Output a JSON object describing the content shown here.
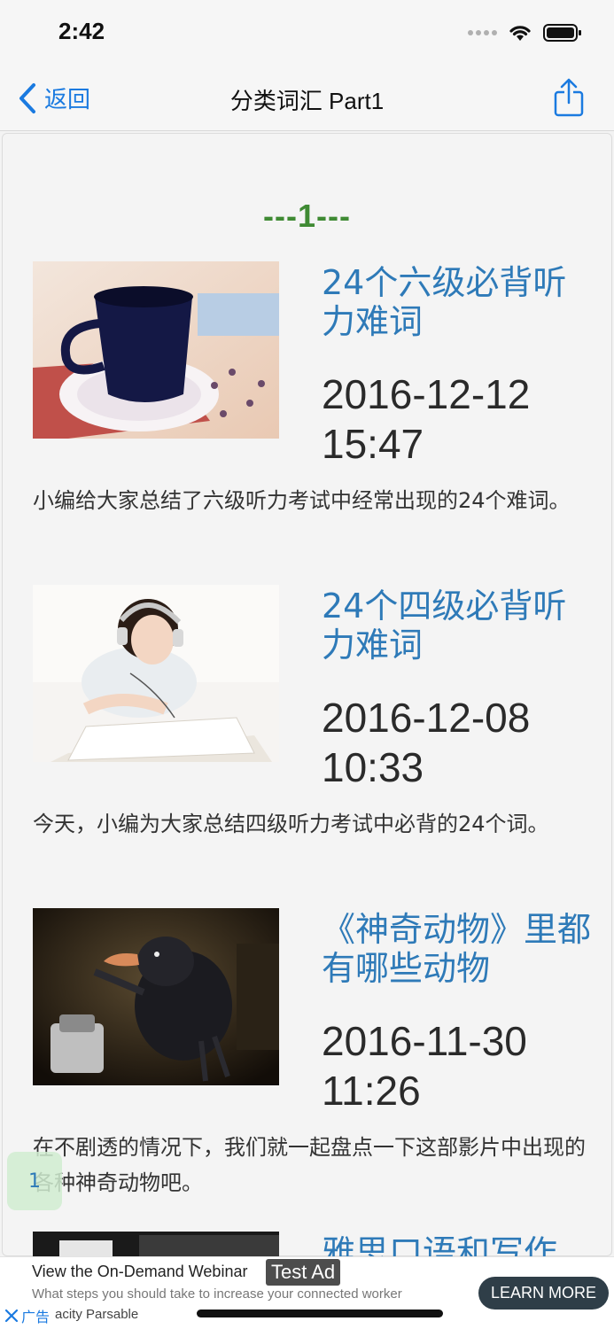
{
  "status_bar": {
    "time": "2:42"
  },
  "nav": {
    "back_label": "返回",
    "title": "分类词汇 Part1"
  },
  "page": {
    "number_label": "---1---"
  },
  "articles": [
    {
      "title": "24个六级必背听力难词",
      "date": "2016-12-12 15:47",
      "summary": "小编给大家总结了六级听力考试中经常出现的24个难词。"
    },
    {
      "title": "24个四级必背听力难词",
      "date": "2016-12-08 10:33",
      "summary": "今天，小编为大家总结四级听力考试中必背的24个词。"
    },
    {
      "title": "《神奇动物》里都有哪些动物",
      "date": "2016-11-30 11:26",
      "summary": "在不剧透的情况下，我们就一起盘点一下这部影片中出现的各种神奇动物吧。"
    },
    {
      "title": "雅思口语和写作"
    }
  ],
  "floating_badge": {
    "label": "1"
  },
  "ad": {
    "title": "View the On-Demand Webinar",
    "label": "Test Ad",
    "subtitle": "What steps you should take to increase your connected worker",
    "sponsor": "acity Parsable",
    "cta": "LEARN MORE",
    "close_label": "广告"
  },
  "colors": {
    "accent": "#1a7ae0",
    "title_blue": "#2e7ab8",
    "page_number_green": "#3f8a33"
  }
}
